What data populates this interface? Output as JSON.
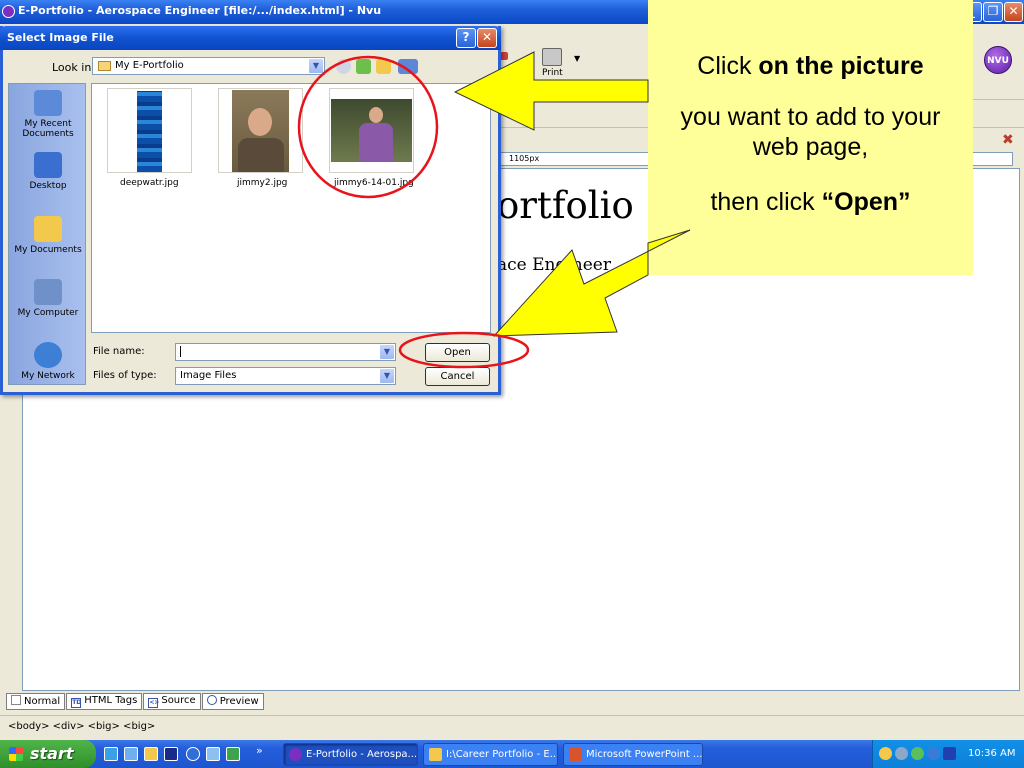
{
  "window": {
    "title": "E-Portfolio - Aerospace Engineer [file:/.../index.html] - Nvu"
  },
  "toolbar": {
    "print_label": "Print",
    "nvu_badge": "NVU"
  },
  "ruler": {
    "width_label": "1105px"
  },
  "page_content": {
    "heading_fragment": "ortfolio",
    "subtitle_fragment": "ace Engineer"
  },
  "mode_tabs": [
    {
      "label": "Normal",
      "icon": "page-icon"
    },
    {
      "label": "HTML Tags",
      "icon": "td-icon"
    },
    {
      "label": "Source",
      "icon": "source-icon"
    },
    {
      "label": "Preview",
      "icon": "magnifier-icon"
    }
  ],
  "status_bar": {
    "breadcrumb": "<body>  <div>  <big>  <big>"
  },
  "dialog": {
    "title": "Select Image File",
    "look_in_label": "Look in:",
    "look_in_value": "My E-Portfolio",
    "places": [
      {
        "label": "My Recent Documents",
        "icon": "recent-documents-icon",
        "color": "#5a8ad8"
      },
      {
        "label": "Desktop",
        "icon": "desktop-icon",
        "color": "#3a6fcf"
      },
      {
        "label": "My Documents",
        "icon": "my-documents-folder-icon",
        "color": "#f2c94c"
      },
      {
        "label": "My Computer",
        "icon": "my-computer-icon",
        "color": "#6f90c8"
      },
      {
        "label": "My Network",
        "icon": "my-network-icon",
        "color": "#3d7fd4"
      }
    ],
    "files": [
      {
        "name": "deepwatr.jpg"
      },
      {
        "name": "jimmy2.jpg"
      },
      {
        "name": "jimmy6-14-01.jpg"
      }
    ],
    "file_name_label": "File name:",
    "file_name_value": "",
    "file_type_label": "Files of type:",
    "file_type_value": "Image Files",
    "open_label": "Open",
    "cancel_label": "Cancel"
  },
  "callout": {
    "line1_pre": "Click ",
    "line1_bold": "on the picture",
    "line2": "you want to add to your web page,",
    "line3_pre": "then click ",
    "line3_bold": "“Open”"
  },
  "taskbar": {
    "start_label": "start",
    "tasks": [
      {
        "label": "E-Portfolio - Aerospa...",
        "active": true
      },
      {
        "label": "I:\\Career Portfolio - E...",
        "active": false
      },
      {
        "label": "Microsoft PowerPoint ...",
        "active": false
      }
    ],
    "clock": "10:36 AM"
  },
  "colors": {
    "annotation_red": "#e8141b",
    "arrow_yellow": "#ffff00",
    "callout_bg": "#ffff99"
  }
}
